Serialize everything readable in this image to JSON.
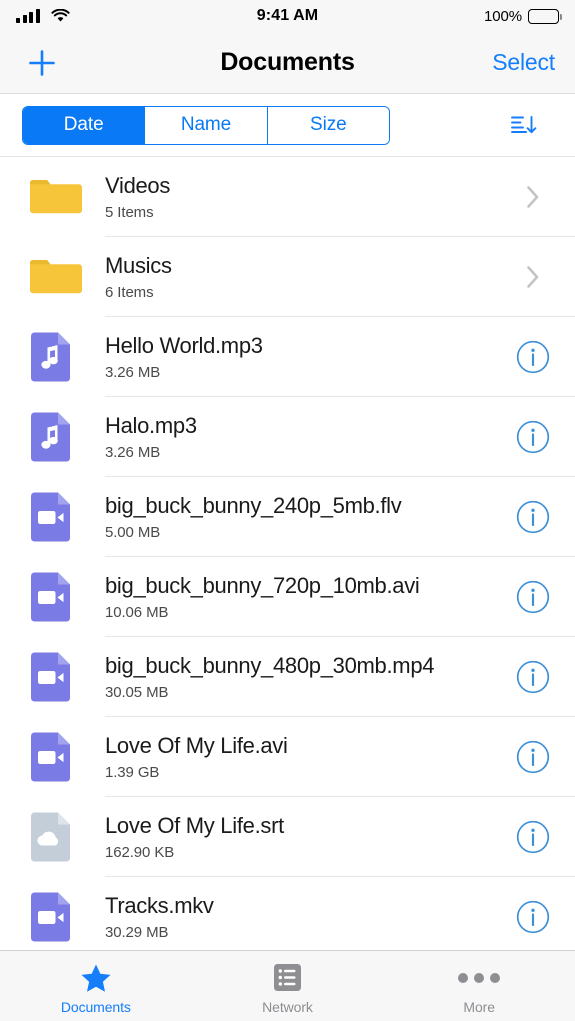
{
  "status_bar": {
    "signal_icon": "cellular-signal-icon",
    "wifi_icon": "wifi-icon",
    "time": "9:41 AM",
    "battery_percent": "100%",
    "battery_icon": "battery-full-icon"
  },
  "nav_bar": {
    "add_icon": "plus-icon",
    "title": "Documents",
    "select_label": "Select"
  },
  "sort_bar": {
    "segments": [
      {
        "label": "Date",
        "active": true
      },
      {
        "label": "Name",
        "active": false
      },
      {
        "label": "Size",
        "active": false
      }
    ],
    "sort_direction_icon": "sort-descending-icon",
    "accent_color": "#0a79f6"
  },
  "files": [
    {
      "name": "Videos",
      "detail": "5 Items",
      "icon": "folder-icon",
      "kind": "folder",
      "accessory": "chevron-right-icon"
    },
    {
      "name": "Musics",
      "detail": "6 Items",
      "icon": "folder-icon",
      "kind": "folder",
      "accessory": "chevron-right-icon"
    },
    {
      "name": "Hello World.mp3",
      "detail": "3.26 MB",
      "icon": "audio-file-icon",
      "kind": "audio",
      "accessory": "info-icon"
    },
    {
      "name": "Halo.mp3",
      "detail": "3.26 MB",
      "icon": "audio-file-icon",
      "kind": "audio",
      "accessory": "info-icon"
    },
    {
      "name": "big_buck_bunny_240p_5mb.flv",
      "detail": "5.00 MB",
      "icon": "video-file-icon",
      "kind": "video",
      "accessory": "info-icon"
    },
    {
      "name": "big_buck_bunny_720p_10mb.avi",
      "detail": "10.06 MB",
      "icon": "video-file-icon",
      "kind": "video",
      "accessory": "info-icon"
    },
    {
      "name": "big_buck_bunny_480p_30mb.mp4",
      "detail": "30.05 MB",
      "icon": "video-file-icon",
      "kind": "video",
      "accessory": "info-icon"
    },
    {
      "name": "Love Of My Life.avi",
      "detail": "1.39 GB",
      "icon": "video-file-icon",
      "kind": "video",
      "accessory": "info-icon"
    },
    {
      "name": "Love Of My Life.srt",
      "detail": "162.90 KB",
      "icon": "cloud-file-icon",
      "kind": "subtitle",
      "accessory": "info-icon"
    },
    {
      "name": "Tracks.mkv",
      "detail": "30.29 MB",
      "icon": "video-file-icon",
      "kind": "video",
      "accessory": "info-icon"
    }
  ],
  "tab_bar": {
    "tabs": [
      {
        "label": "Documents",
        "icon": "star-icon",
        "active": true
      },
      {
        "label": "Network",
        "icon": "list-icon",
        "active": false
      },
      {
        "label": "More",
        "icon": "ellipsis-icon",
        "active": false
      }
    ]
  },
  "colors": {
    "folder": "#f7c53a",
    "media_file": "#7b7be6",
    "subtitle_file": "#c3ced8",
    "tint": "#147efb"
  }
}
